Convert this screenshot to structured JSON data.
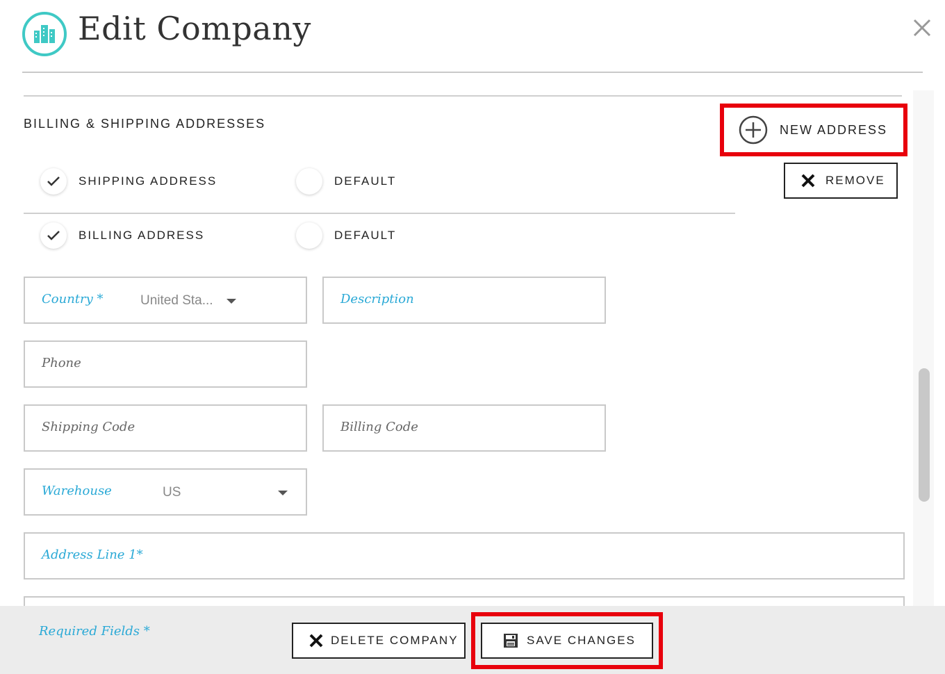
{
  "header": {
    "title": "Edit Company"
  },
  "addresses": {
    "section_title": "BILLING & SHIPPING ADDRESSES",
    "new_address_label": "NEW ADDRESS",
    "remove_label": "REMOVE",
    "shipping_label": "SHIPPING ADDRESS",
    "shipping_checked": true,
    "shipping_default_label": "DEFAULT",
    "billing_label": "BILLING ADDRESS",
    "billing_checked": true,
    "billing_default_label": "DEFAULT"
  },
  "form": {
    "country_label": "Country *",
    "country_value": "United Sta...",
    "description_label": "Description",
    "phone_label": "Phone",
    "shipping_code_label": "Shipping Code",
    "billing_code_label": "Billing Code",
    "warehouse_label": "Warehouse",
    "warehouse_value": "US",
    "address_line1_label": "Address Line 1*"
  },
  "footer": {
    "required_note": "Required Fields *",
    "delete_label": "DELETE COMPANY",
    "save_label": "SAVE CHANGES"
  },
  "colors": {
    "accent": "#2aa9d6",
    "logo": "#3fc9c5",
    "highlight": "#e8000c"
  }
}
